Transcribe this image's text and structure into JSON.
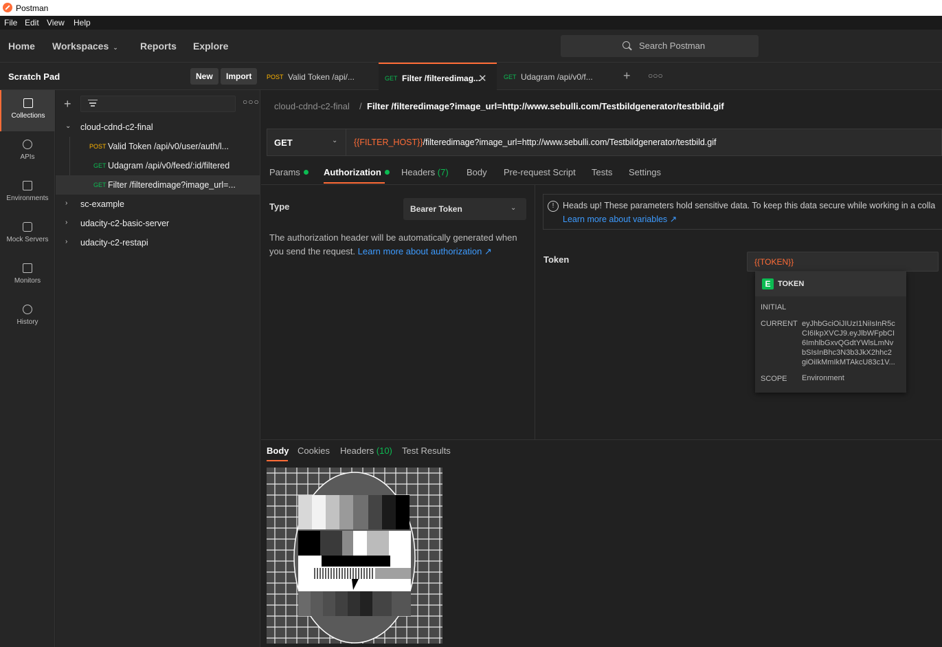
{
  "window": {
    "title": "Postman"
  },
  "menu": [
    "File",
    "Edit",
    "View",
    "Help"
  ],
  "topnav": {
    "home": "Home",
    "workspaces": "Workspaces",
    "reports": "Reports",
    "explore": "Explore",
    "search_placeholder": "Search Postman"
  },
  "sidebar": {
    "title": "Scratch Pad",
    "new_label": "New",
    "import_label": "Import",
    "rail": [
      "Collections",
      "APIs",
      "Environments",
      "Mock Servers",
      "Monitors",
      "History"
    ],
    "tree": {
      "collections": [
        "cloud-cdnd-c2-final",
        "sc-example",
        "udacity-c2-basic-server",
        "udacity-c2-restapi"
      ],
      "requests": [
        {
          "method": "POST",
          "name": "Valid Token /api/v0/user/auth/l..."
        },
        {
          "method": "GET",
          "name": "Udagram /api/v0/feed/:id/filtered"
        },
        {
          "method": "GET",
          "name": "Filter /filteredimage?image_url=..."
        }
      ]
    }
  },
  "tabs": [
    {
      "method": "POST",
      "name": "Valid Token /api/..."
    },
    {
      "method": "GET",
      "name": "Filter /filteredimag..."
    },
    {
      "method": "GET",
      "name": "Udagram /api/v0/f..."
    }
  ],
  "breadcrumb": {
    "collection": "cloud-cdnd-c2-final",
    "separator": "/",
    "request": "Filter /filteredimage?image_url=http://www.sebulli.com/Testbildgenerator/testbild.gif"
  },
  "request": {
    "method": "GET",
    "url_var": "{{FILTER_HOST}}",
    "url_rest": "/filteredimage?image_url=http://www.sebulli.com/Testbildgenerator/testbild.gif",
    "tabs": {
      "params": "Params",
      "authorization": "Authorization",
      "headers": "Headers",
      "headers_count": "(7)",
      "body": "Body",
      "prerequest": "Pre-request Script",
      "tests": "Tests",
      "settings": "Settings"
    }
  },
  "auth": {
    "type_label": "Type",
    "type_value": "Bearer Token",
    "desc": "The authorization header will be automatically generated when you send the request.",
    "desc_link": "Learn more about authorization ↗",
    "warning": "Heads up! These parameters hold sensitive data. To keep this data secure while working in a colla",
    "warning_link": "Learn more about variables ↗",
    "token_label": "Token",
    "token_value": "{{TOKEN}}"
  },
  "popover": {
    "badge": "E",
    "name": "TOKEN",
    "initial_label": "INITIAL",
    "current_label": "CURRENT",
    "current_lines": [
      "eyJhbGciOiJIUzI1NiIsInR5c",
      "CI6IkpXVCJ9.eyJlbWFpbCI",
      "6ImhlbGxvQGdtYWlsLmNv",
      "bSIsInBhc3N3b3JkX2hhc2",
      "giOiIkMmIkMTAkcU83c1V..."
    ],
    "scope_label": "SCOPE",
    "scope_value": "Environment"
  },
  "response": {
    "tabs": {
      "body": "Body",
      "cookies": "Cookies",
      "headers": "Headers",
      "headers_count": "(10)",
      "tests": "Test Results"
    }
  },
  "colors": {
    "accent": "#ff6c37",
    "get": "#0cbb52",
    "post": "#ffb400",
    "link": "#3d9bff"
  }
}
